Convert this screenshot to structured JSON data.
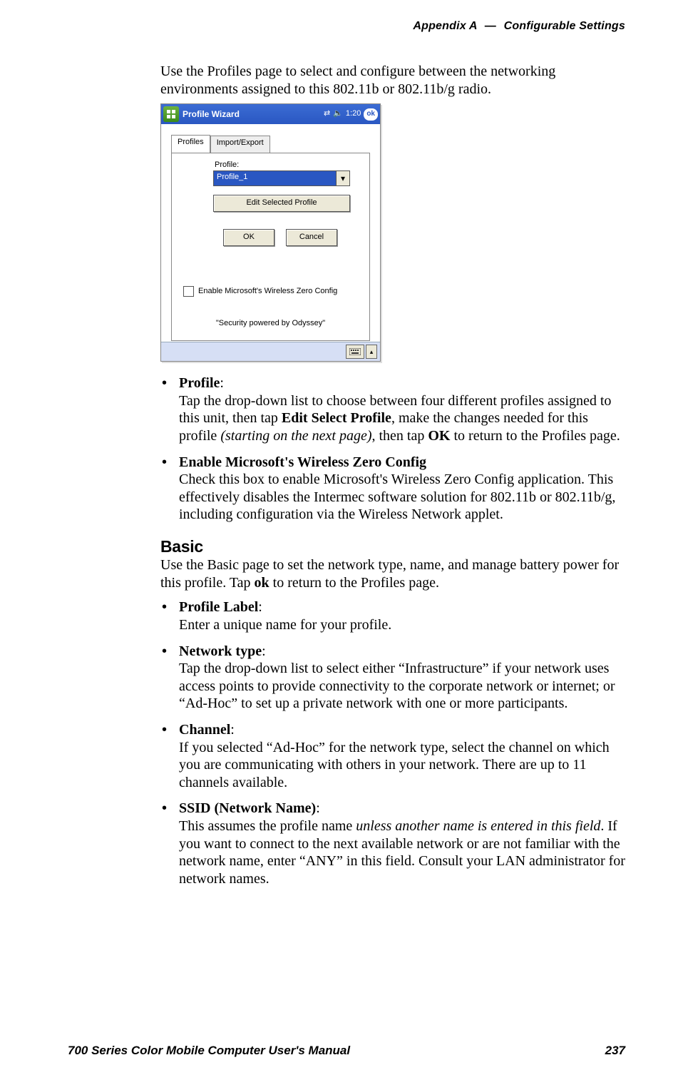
{
  "header": {
    "appendix": "Appendix A",
    "sep": "—",
    "chapter": "Configurable Settings"
  },
  "intro": "Use the Profiles page to select and configure between the networking environments assigned to this 802.11b or 802.11b/g radio.",
  "screenshot": {
    "title": "Profile Wizard",
    "time": "1:20",
    "ok_badge": "ok",
    "tabs": {
      "profiles": "Profiles",
      "importexport": "Import/Export"
    },
    "profile_label": "Profile:",
    "profile_value": "Profile_1",
    "edit_btn": "Edit Selected Profile",
    "ok_btn": "OK",
    "cancel_btn": "Cancel",
    "checkbox": "Enable Microsoft's Wireless Zero Config",
    "powered": "\"Security powered by Odyssey\""
  },
  "list1": {
    "profile": {
      "head": "Profile",
      "body_pre": "Tap the drop-down list to choose between four different profiles assigned to this unit, then tap ",
      "bold1": "Edit Select Profile",
      "body_mid": ", make the changes needed for this profile ",
      "italic": "(starting on the next page)",
      "body_mid2": ", then tap ",
      "bold2": "OK",
      "body_post": " to return to the Profiles page."
    },
    "wzc": {
      "head": "Enable Microsoft's Wireless Zero Config",
      "body": "Check this box to enable Microsoft's Wireless Zero Config application. This effectively disables the Intermec software solution for 802.11b or 802.11b/g, including configuration via the Wireless Network applet."
    }
  },
  "basic": {
    "head": "Basic",
    "intro_pre": "Use the Basic page to set the network type, name, and manage battery power for this profile. Tap ",
    "intro_bold": "ok",
    "intro_post": " to return to the Profiles page.",
    "items": {
      "profile_label": {
        "head": "Profile Label",
        "body": "Enter a unique name for your profile."
      },
      "network_type": {
        "head": "Network type",
        "body": "Tap the drop-down list to select either “Infrastructure” if your network uses access points to provide connectivity to the corporate network or internet; or “Ad-Hoc” to set up a private network with one or more participants."
      },
      "channel": {
        "head": "Channel",
        "body": "If you selected “Ad-Hoc” for the network type, select the channel on which you are communicating with others in your network. There are up to 11 channels available."
      },
      "ssid": {
        "head": "SSID (Network Name)",
        "body_pre": "This assumes the profile name ",
        "italic": "unless another name is entered in this field",
        "body_post": ". If you want to connect to the next available network or are not familiar with the network name, enter “ANY” in this field. Consult your LAN administrator for network names."
      }
    }
  },
  "footer": {
    "left": "700 Series Color Mobile Computer User's Manual",
    "right": "237"
  }
}
